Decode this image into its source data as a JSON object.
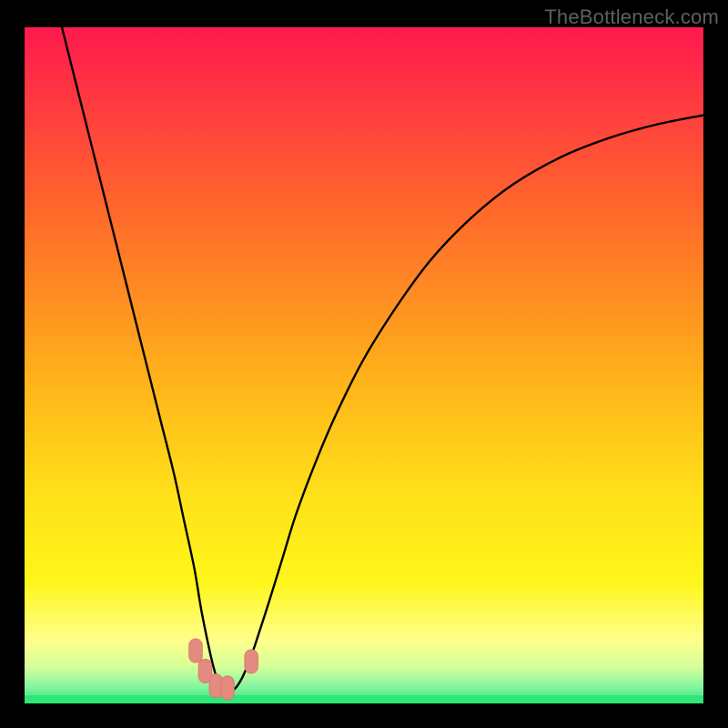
{
  "watermark": "TheBottleneck.com",
  "colors": {
    "page_bg": "#000000",
    "watermark": "#5f5f5f",
    "curve": "#000000",
    "marker_fill": "#e48b80",
    "marker_stroke": "#d87a6f",
    "band_green": "#2fe678",
    "gradient_stops": [
      {
        "offset": 0.0,
        "color": "#ff1a4e"
      },
      {
        "offset": 0.28,
        "color": "#ff6a2a"
      },
      {
        "offset": 0.52,
        "color": "#ffb21a"
      },
      {
        "offset": 0.7,
        "color": "#ffe21a"
      },
      {
        "offset": 0.82,
        "color": "#fff61a"
      },
      {
        "offset": 0.905,
        "color": "#ffff8a"
      },
      {
        "offset": 0.945,
        "color": "#d7ff9a"
      },
      {
        "offset": 0.975,
        "color": "#86f5a0"
      },
      {
        "offset": 1.0,
        "color": "#2fe678"
      }
    ]
  },
  "chart_data": {
    "type": "line",
    "title": "",
    "xlabel": "",
    "ylabel": "",
    "xlim": [
      0,
      100
    ],
    "ylim": [
      0,
      100
    ],
    "series": [
      {
        "name": "bottleneck-curve",
        "x": [
          5.5,
          8,
          10,
          12,
          14,
          16,
          18,
          20,
          22,
          23.5,
          25,
          26,
          27,
          27.8,
          28.5,
          29.2,
          30,
          31,
          32,
          33,
          34,
          36,
          38,
          40,
          43,
          46,
          50,
          55,
          60,
          66,
          72,
          79,
          86,
          93,
          100
        ],
        "values": [
          100,
          90,
          82,
          74,
          66,
          58,
          50,
          42,
          34,
          27,
          20,
          14,
          9,
          5.5,
          3.2,
          2.0,
          1.6,
          2.2,
          3.7,
          6.0,
          8.8,
          15,
          21.5,
          28,
          36,
          43,
          51,
          59,
          65.8,
          72,
          76.8,
          80.8,
          83.6,
          85.6,
          87
        ]
      }
    ],
    "markers": [
      {
        "x": 25.2,
        "y": 7.8
      },
      {
        "x": 26.6,
        "y": 4.8
      },
      {
        "x": 28.2,
        "y": 2.6
      },
      {
        "x": 29.9,
        "y": 2.3
      },
      {
        "x": 33.4,
        "y": 6.2
      }
    ]
  }
}
